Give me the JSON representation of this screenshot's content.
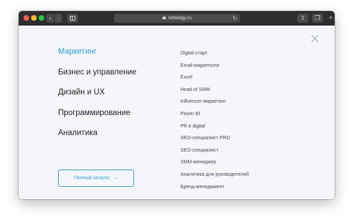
{
  "browser": {
    "url": "netology.ru",
    "back_glyph": "‹",
    "forward_glyph": "›",
    "reload_glyph": "↻",
    "share_glyph": "⇧",
    "tabs_glyph": "❐",
    "new_tab_glyph": "+"
  },
  "menu": {
    "categories": [
      {
        "label": "Маркетинг",
        "active": true
      },
      {
        "label": "Бизнес и управление",
        "active": false
      },
      {
        "label": "Дизайн и UX",
        "active": false
      },
      {
        "label": "Программирование",
        "active": false
      },
      {
        "label": "Аналитика",
        "active": false
      }
    ],
    "subcategories": [
      "Digital-старт",
      "Email-маркетолог",
      "Excel",
      "Head of SMM",
      "Influencer-маркетинг",
      "Power BI",
      "PR в digital",
      "SEO-специалист PRO",
      "SEO-специалист",
      "SMM-менеджер",
      "Аналитика для руководителей",
      "Бренд-менеджмент"
    ],
    "catalog_button": "Полный каталог",
    "catalog_arrow": "→"
  },
  "colors": {
    "accent": "#2e9ccf",
    "background": "#f4f6f9",
    "toolbar": "#2e2e2f"
  },
  "icons": [
    "close-icon",
    "lock-icon",
    "reload-icon",
    "share-icon",
    "tabs-icon",
    "sidebar-icon",
    "arrow-right-icon"
  ]
}
